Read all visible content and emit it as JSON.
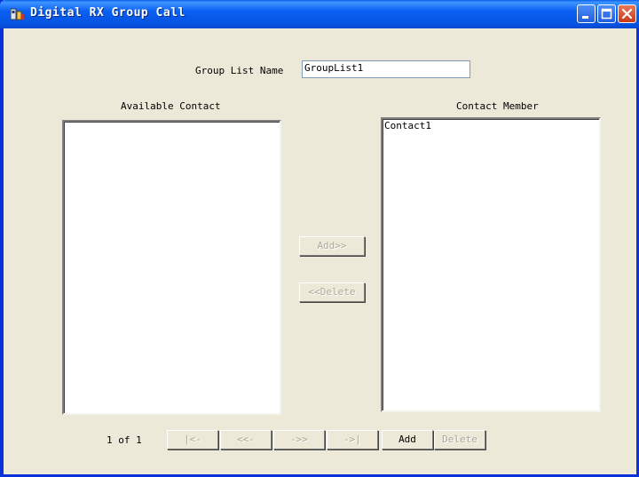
{
  "window": {
    "title": "Digital RX Group Call"
  },
  "form": {
    "group_list_name_label": "Group List Name",
    "group_list_name_value": "GroupList1"
  },
  "available": {
    "header": "Available Contact",
    "items": []
  },
  "members": {
    "header": "Contact Member",
    "items": [
      "Contact1"
    ]
  },
  "transfer": {
    "add_label": "Add>>",
    "delete_label": "<<Delete"
  },
  "pager": {
    "page_text": "1 of 1",
    "first_label": "|<-",
    "prev_label": "<<-",
    "next_label": "->>",
    "last_label": "->|",
    "add_label": "Add",
    "delete_label": "Delete"
  },
  "colors": {
    "titlebar": "#0a5ff2",
    "frame": "#0831d9",
    "face": "#ece9d8",
    "close_button": "#c8391b"
  }
}
